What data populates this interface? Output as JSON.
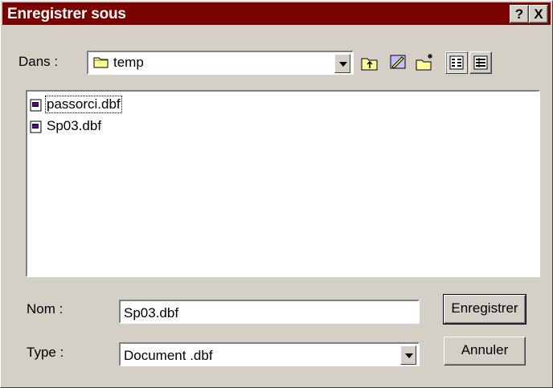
{
  "dialog": {
    "title": "Enregistrer sous",
    "help_label": "?",
    "close_label": "X"
  },
  "location": {
    "label": "Dans :",
    "folder": "temp"
  },
  "files": [
    {
      "name": "passorci.dbf"
    },
    {
      "name": "Sp03.dbf"
    }
  ],
  "filename": {
    "label": "Nom :",
    "value": "Sp03.dbf"
  },
  "filetype": {
    "label": "Type :",
    "value": "Document .dbf"
  },
  "buttons": {
    "save": "Enregistrer",
    "cancel": "Annuler"
  }
}
